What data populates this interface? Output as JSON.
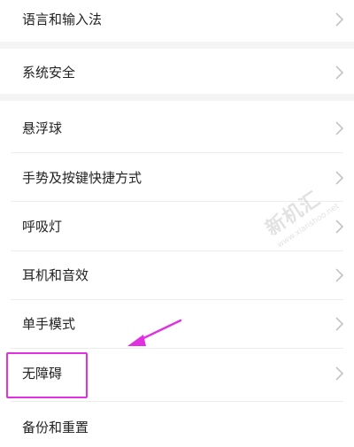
{
  "settings": {
    "items": [
      {
        "label": "语言和输入法"
      },
      {
        "label": "系统安全"
      },
      {
        "label": "悬浮球"
      },
      {
        "label": "手势及按键快捷方式"
      },
      {
        "label": "呼吸灯"
      },
      {
        "label": "耳机和音效"
      },
      {
        "label": "单手模式"
      },
      {
        "label": "无障碍"
      },
      {
        "label": "备份和重置"
      }
    ]
  },
  "annotation": {
    "color": "#e030e0"
  },
  "watermark": {
    "main": "新机汇",
    "sub": "www.xianshoo.net"
  },
  "colors": {
    "text": "#222222",
    "chevron": "#c2c2c2",
    "section_gap": "#f4f4f4",
    "divider": "#ececec"
  }
}
